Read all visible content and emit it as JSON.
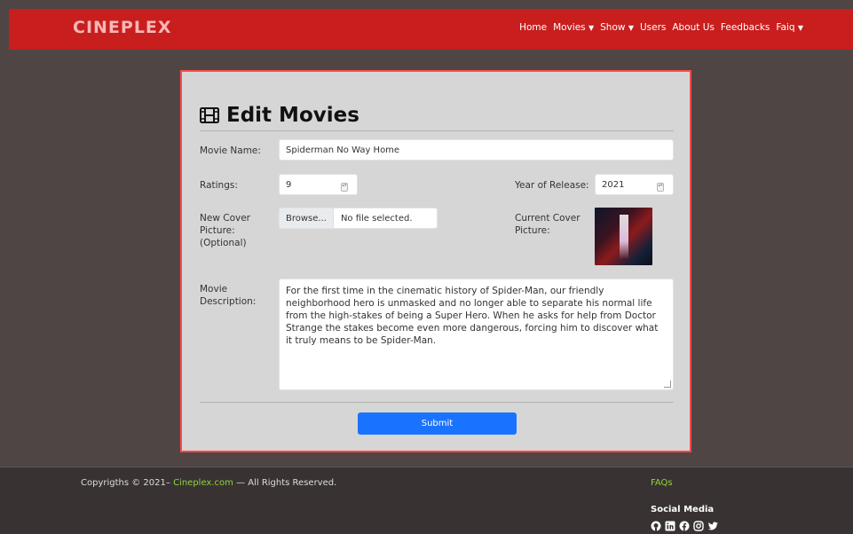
{
  "brand": "CINEPLEX",
  "nav": {
    "home": "Home",
    "movies": "Movies",
    "show": "Show",
    "users": "Users",
    "about": "About Us",
    "feedbacks": "Feedbacks",
    "faq": "Faiq"
  },
  "form": {
    "title": "Edit Movies",
    "movie_name_label": "Movie Name:",
    "movie_name_value": "Spiderman No Way Home",
    "ratings_label": "Ratings:",
    "ratings_value": "9",
    "year_label": "Year of Release:",
    "year_value": "2021",
    "cover_label": "New Cover Picture: (Optional)",
    "browse_label": "Browse...",
    "no_file": "No file selected.",
    "current_cover_label": "Current Cover Picture:",
    "description_label": "Movie Description:",
    "description_value": "For the first time in the cinematic history of Spider-Man, our friendly neighborhood hero is unmasked and no longer able to separate his normal life from the high-stakes of being a Super Hero. When he asks for help from Doctor Strange the stakes become even more dangerous, forcing him to discover what it truly means to be Spider-Man.",
    "submit_label": "Submit"
  },
  "footer": {
    "copyright_prefix": "Copyrigths © 2021–",
    "site": "Cineplex.com",
    "copyright_suffix": "— All Rights Reserved.",
    "faqs": "FAQs",
    "social_title": "Social Media",
    "icons": [
      "github-icon",
      "linkedin-icon",
      "facebook-icon",
      "instagram-icon",
      "twitter-icon"
    ]
  },
  "colors": {
    "navbar": "#c91e1e",
    "background": "#4f4545",
    "card": "#d6d6d6",
    "card_border": "#ff4a4a",
    "submit": "#1a73ff",
    "footer": "#393232",
    "accent_green": "#8fd63b"
  }
}
